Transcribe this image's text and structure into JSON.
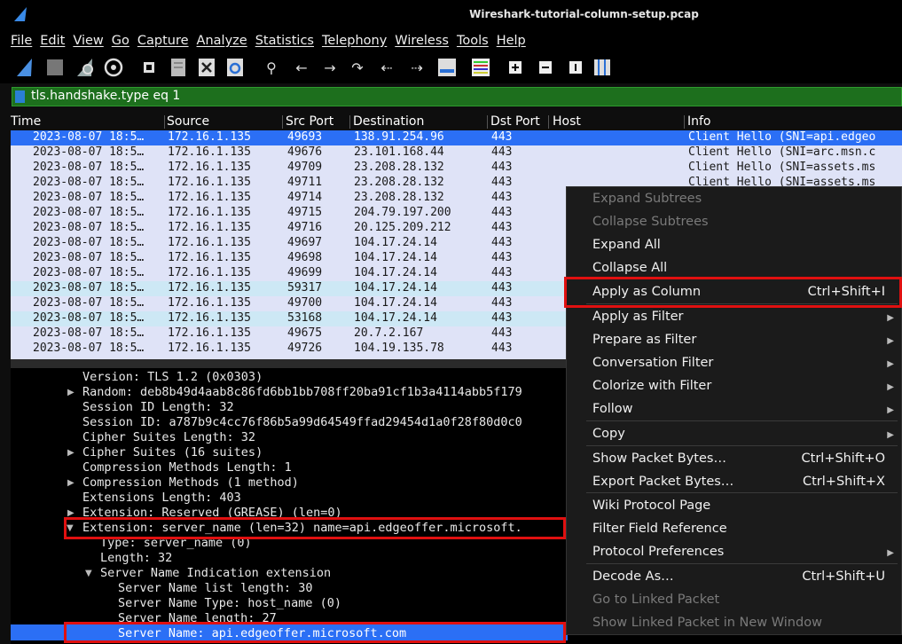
{
  "window": {
    "title": "Wireshark-tutorial-column-setup.pcap"
  },
  "menubar": [
    "File",
    "Edit",
    "View",
    "Go",
    "Capture",
    "Analyze",
    "Statistics",
    "Telephony",
    "Wireless",
    "Tools",
    "Help"
  ],
  "toolbar": {
    "search_glyph": "⚲",
    "back_glyph": "←",
    "forward_glyph": "→",
    "jump_glyph": "↷",
    "first_glyph": "⇠",
    "last_glyph": "⇢"
  },
  "filter": {
    "value": "tls.handshake.type eq 1"
  },
  "columns": {
    "time": "Time",
    "source": "Source",
    "src_port": "Src Port",
    "destination": "Destination",
    "dst_port": "Dst Port",
    "host": "Host",
    "info": "Info"
  },
  "packets": [
    {
      "time": "2023-08-07 18:5…",
      "source": "172.16.1.135",
      "src_port": "49693",
      "destination": "138.91.254.96",
      "dst_port": "443",
      "info": "Client Hello (SNI=api.edgeo"
    },
    {
      "time": "2023-08-07 18:5…",
      "source": "172.16.1.135",
      "src_port": "49676",
      "destination": "23.101.168.44",
      "dst_port": "443",
      "info": "Client Hello (SNI=arc.msn.c"
    },
    {
      "time": "2023-08-07 18:5…",
      "source": "172.16.1.135",
      "src_port": "49709",
      "destination": "23.208.28.132",
      "dst_port": "443",
      "info": "Client Hello (SNI=assets.ms"
    },
    {
      "time": "2023-08-07 18:5…",
      "source": "172.16.1.135",
      "src_port": "49711",
      "destination": "23.208.28.132",
      "dst_port": "443",
      "info": "Client Hello (SNI=assets.ms"
    },
    {
      "time": "2023-08-07 18:5…",
      "source": "172.16.1.135",
      "src_port": "49714",
      "destination": "23.208.28.132",
      "dst_port": "443",
      "info": ""
    },
    {
      "time": "2023-08-07 18:5…",
      "source": "172.16.1.135",
      "src_port": "49715",
      "destination": "204.79.197.200",
      "dst_port": "443",
      "info": ""
    },
    {
      "time": "2023-08-07 18:5…",
      "source": "172.16.1.135",
      "src_port": "49716",
      "destination": "20.125.209.212",
      "dst_port": "443",
      "info": ""
    },
    {
      "time": "2023-08-07 18:5…",
      "source": "172.16.1.135",
      "src_port": "49697",
      "destination": "104.17.24.14",
      "dst_port": "443",
      "info": ""
    },
    {
      "time": "2023-08-07 18:5…",
      "source": "172.16.1.135",
      "src_port": "49698",
      "destination": "104.17.24.14",
      "dst_port": "443",
      "info": ""
    },
    {
      "time": "2023-08-07 18:5…",
      "source": "172.16.1.135",
      "src_port": "49699",
      "destination": "104.17.24.14",
      "dst_port": "443",
      "info": ""
    },
    {
      "time": "2023-08-07 18:5…",
      "source": "172.16.1.135",
      "src_port": "59317",
      "destination": "104.17.24.14",
      "dst_port": "443",
      "info": ""
    },
    {
      "time": "2023-08-07 18:5…",
      "source": "172.16.1.135",
      "src_port": "49700",
      "destination": "104.17.24.14",
      "dst_port": "443",
      "info": ""
    },
    {
      "time": "2023-08-07 18:5…",
      "source": "172.16.1.135",
      "src_port": "53168",
      "destination": "104.17.24.14",
      "dst_port": "443",
      "info": ""
    },
    {
      "time": "2023-08-07 18:5…",
      "source": "172.16.1.135",
      "src_port": "49675",
      "destination": "20.7.2.167",
      "dst_port": "443",
      "info": ""
    },
    {
      "time": "2023-08-07 18:5…",
      "source": "172.16.1.135",
      "src_port": "49726",
      "destination": "104.19.135.78",
      "dst_port": "443",
      "info": ""
    }
  ],
  "details": [
    "Version: TLS 1.2 (0x0303)",
    "Random: deb8b49d4aab8c86fd6bb1bb708ff20ba91cf1b3a4114abb5f179",
    "Session ID Length: 32",
    "Session ID: a787b9c4cc76f86b5a99d64549ffad29454d1a0f28f80d0c0",
    "Cipher Suites Length: 32",
    "Cipher Suites (16 suites)",
    "Compression Methods Length: 1",
    "Compression Methods (1 method)",
    "Extensions Length: 403",
    "Extension: Reserved (GREASE) (len=0)",
    "Extension: server_name (len=32) name=api.edgeoffer.microsoft.",
    "Type: server_name (0)",
    "Length: 32",
    "Server Name Indication extension",
    "Server Name list length: 30",
    "Server Name Type: host_name (0)",
    "Server Name length: 27",
    "Server Name: api.edgeoffer.microsoft.com"
  ],
  "context_menu": [
    {
      "label": "Expand Subtrees",
      "shortcut": "",
      "submenu": false,
      "disabled": true
    },
    {
      "label": "Collapse Subtrees",
      "shortcut": "",
      "submenu": false,
      "disabled": true
    },
    {
      "label": "Expand All",
      "shortcut": "",
      "submenu": false,
      "disabled": false
    },
    {
      "label": "Collapse All",
      "shortcut": "",
      "submenu": false,
      "disabled": false
    },
    {
      "label": "Apply as Column",
      "shortcut": "Ctrl+Shift+I",
      "submenu": false,
      "disabled": false
    },
    {
      "label": "Apply as Filter",
      "shortcut": "",
      "submenu": true,
      "disabled": false
    },
    {
      "label": "Prepare as Filter",
      "shortcut": "",
      "submenu": true,
      "disabled": false
    },
    {
      "label": "Conversation Filter",
      "shortcut": "",
      "submenu": true,
      "disabled": false
    },
    {
      "label": "Colorize with Filter",
      "shortcut": "",
      "submenu": true,
      "disabled": false
    },
    {
      "label": "Follow",
      "shortcut": "",
      "submenu": true,
      "disabled": false
    },
    {
      "label": "Copy",
      "shortcut": "",
      "submenu": true,
      "disabled": false
    },
    {
      "label": "Show Packet Bytes…",
      "shortcut": "Ctrl+Shift+O",
      "submenu": false,
      "disabled": false
    },
    {
      "label": "Export Packet Bytes…",
      "shortcut": "Ctrl+Shift+X",
      "submenu": false,
      "disabled": false
    },
    {
      "label": "Wiki Protocol Page",
      "shortcut": "",
      "submenu": false,
      "disabled": false
    },
    {
      "label": "Filter Field Reference",
      "shortcut": "",
      "submenu": false,
      "disabled": false
    },
    {
      "label": "Protocol Preferences",
      "shortcut": "",
      "submenu": true,
      "disabled": false
    },
    {
      "label": "Decode As…",
      "shortcut": "Ctrl+Shift+U",
      "submenu": false,
      "disabled": false
    },
    {
      "label": "Go to Linked Packet",
      "shortcut": "",
      "submenu": false,
      "disabled": true
    },
    {
      "label": "Show Linked Packet in New Window",
      "shortcut": "",
      "submenu": false,
      "disabled": true
    }
  ]
}
